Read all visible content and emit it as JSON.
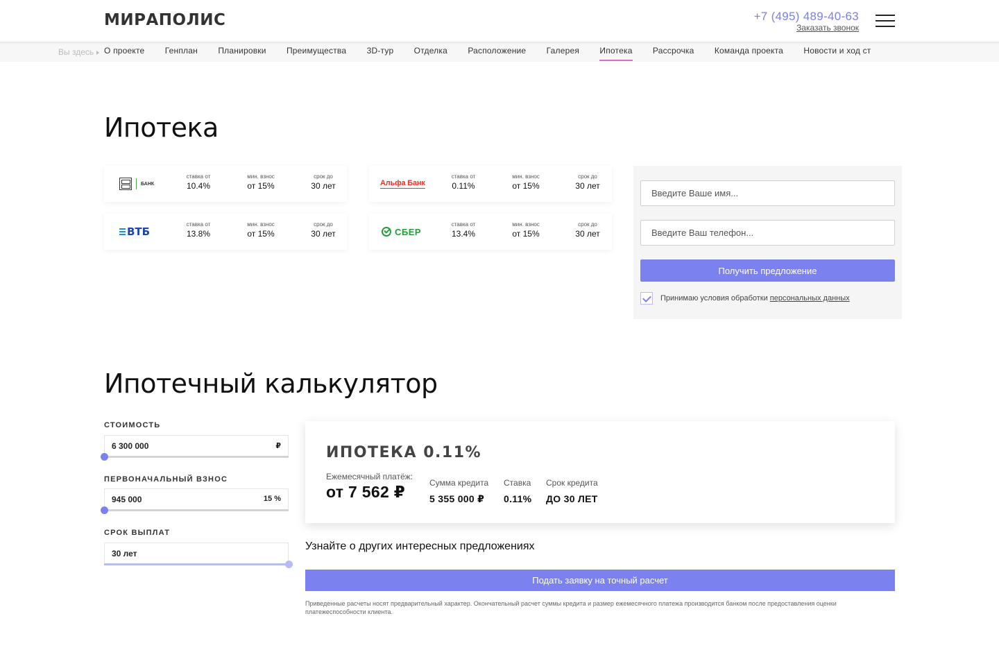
{
  "header": {
    "logo": "МИРАПОЛИС",
    "phone": "+7 (495) 489-40-63",
    "callback": "Заказать звонок"
  },
  "breadcrumb": {
    "here": "Вы здесь"
  },
  "nav": {
    "items": [
      "О проекте",
      "Генплан",
      "Планировки",
      "Преимущества",
      "3D-тур",
      "Отделка",
      "Расположение",
      "Галерея",
      "Ипотека",
      "Рассрочка",
      "Команда проекта",
      "Новости и ход ст"
    ],
    "active": "Ипотека"
  },
  "mortgage": {
    "title": "Ипотека",
    "banks": [
      {
        "name": "ДОМ.РФ",
        "logo_text": "БАНК",
        "rate_label": "ставка от",
        "rate": "10.4%",
        "down_label": "мин. взнос",
        "down": "от 15%",
        "term_label": "срок до",
        "term": "30 лет"
      },
      {
        "name": "Альфа Банк",
        "logo_text": "Альфа Банк",
        "rate_label": "ставка от",
        "rate": "0.11%",
        "down_label": "мин. взнос",
        "down": "от 15%",
        "term_label": "срок до",
        "term": "30 лет"
      },
      {
        "name": "ВТБ",
        "logo_text": "ВТБ",
        "rate_label": "ставка от",
        "rate": "13.8%",
        "down_label": "мин. взнос",
        "down": "от 15%",
        "term_label": "срок до",
        "term": "30 лет"
      },
      {
        "name": "СБЕР",
        "logo_text": "СБЕР",
        "rate_label": "ставка от",
        "rate": "13.4%",
        "down_label": "мин. взнос",
        "down": "от 15%",
        "term_label": "срок до",
        "term": "30 лет"
      }
    ]
  },
  "form": {
    "name_placeholder": "Введите Ваше имя...",
    "phone_placeholder": "Введите Ваш телефон...",
    "submit": "Получить предложение",
    "consent_text": "Принимаю условия обработки",
    "consent_link": "персональных данных",
    "consent_checked": true
  },
  "calculator": {
    "title": "Ипотечный калькулятор",
    "cost": {
      "label": "СТОИМОСТЬ",
      "value": "6 300 000",
      "suffix": "₽",
      "slider_fraction": 0.0
    },
    "down_payment": {
      "label": "ПЕРВОНАЧАЛЬНЫЙ ВЗНОС",
      "value": "945 000",
      "suffix": "15 %",
      "slider_fraction": 0.0
    },
    "term": {
      "label": "СРОК ВЫПЛАТ",
      "value": "30 лет",
      "slider_fraction": 1.0
    }
  },
  "result": {
    "title": "ИПОТЕКА 0.11%",
    "monthly_label": "Ежемесячный платёж:",
    "monthly_value": "от 7 562 ₽",
    "loan_label": "Сумма кредита",
    "loan_value": "5 355 000 ₽",
    "rate_label": "Ставка",
    "rate_value": "0.11%",
    "term_label": "Срок кредита",
    "term_value": "ДО 30 ЛЕТ"
  },
  "other_offers": "Узнайте о других интересных предложениях",
  "request_button": "Подать заявку на точный расчет",
  "disclaimer": "Приведенные расчеты носят предварительный характер. Окончательный расчет суммы кредита и размер ежемесячного платежа производится банком после предоставления оценки платежеспособности клиента.",
  "colors": {
    "accent": "#7b82f0",
    "nav_active": "#e168c8",
    "phone": "#7b80ee"
  }
}
